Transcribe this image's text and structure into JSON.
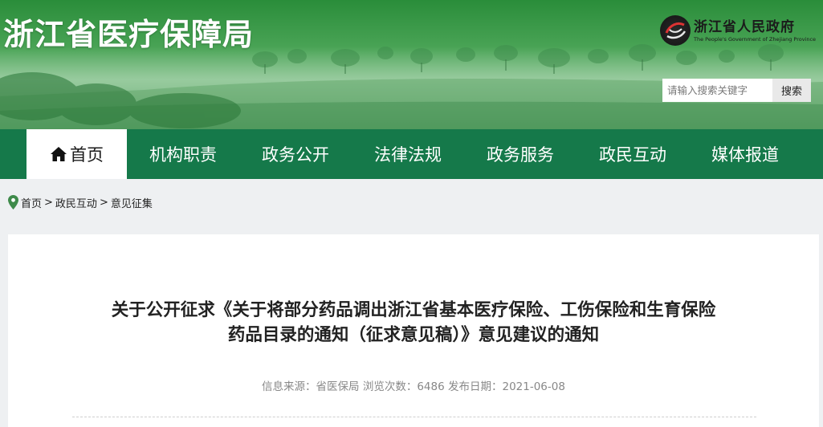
{
  "site": {
    "title": "浙江省医疗保障局",
    "gov_name": "浙江省人民政府",
    "gov_name_en": "The People's Government of Zhejiang Province"
  },
  "search": {
    "placeholder": "请输入搜索关键字",
    "button_label": "搜索"
  },
  "nav": {
    "items": [
      {
        "label": "首页",
        "icon": "home-icon",
        "active": true
      },
      {
        "label": "机构职责"
      },
      {
        "label": "政务公开"
      },
      {
        "label": "法律法规"
      },
      {
        "label": "政务服务"
      },
      {
        "label": "政民互动"
      },
      {
        "label": "媒体报道"
      }
    ]
  },
  "breadcrumb": {
    "icon": "location-pin-icon",
    "items": [
      "首页",
      "政民互动",
      "意见征集"
    ],
    "separator": ">"
  },
  "article": {
    "title_line1": "关于公开征求《关于将部分药品调出浙江省基本医疗保险、工伤保险和生育保险",
    "title_line2": "药品目录的通知（征求意见稿）》意见建议的通知",
    "meta": {
      "source_label": "信息来源：",
      "source": "省医保局",
      "views_label": "浏览次数：",
      "views": "6486",
      "date_label": "发布日期：",
      "date": "2021-06-08"
    }
  },
  "colors": {
    "nav_bg": "#15794a",
    "banner_green": "#4aa456",
    "page_bg": "#eef0f2"
  }
}
